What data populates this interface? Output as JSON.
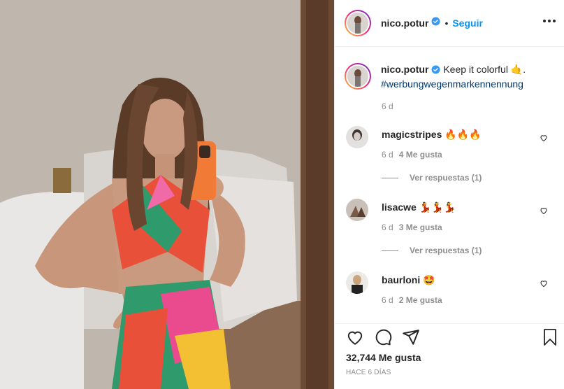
{
  "post": {
    "username": "nico.potur",
    "follow_label": "Seguir",
    "caption_text": "Keep it colorful",
    "caption_emoji": "🤙",
    "caption_hashtag": "#werbungwegenmarkennennung",
    "caption_time": "6 d",
    "likes": "32,744 Me gusta",
    "time_ago": "HACE 6 DÍAS"
  },
  "comments": [
    {
      "username": "magicstripes",
      "text": "🔥🔥🔥",
      "time": "6 d",
      "likes": "4 Me gusta",
      "replies": "Ver respuestas (1)"
    },
    {
      "username": "lisacwe",
      "text": "💃💃💃",
      "time": "6 d",
      "likes": "3 Me gusta",
      "replies": "Ver respuestas (1)"
    },
    {
      "username": "baurloni",
      "text": "🤩",
      "time": "6 d",
      "likes": "2 Me gusta"
    }
  ],
  "colors": {
    "accent": "#0095f6",
    "verified": "#3897f0",
    "hashtag": "#00376b",
    "muted": "#8e8e8e",
    "text": "#262626"
  },
  "icons": [
    "verified-badge-icon",
    "more-options-icon",
    "heart-icon",
    "comment-icon",
    "share-icon",
    "bookmark-icon"
  ]
}
